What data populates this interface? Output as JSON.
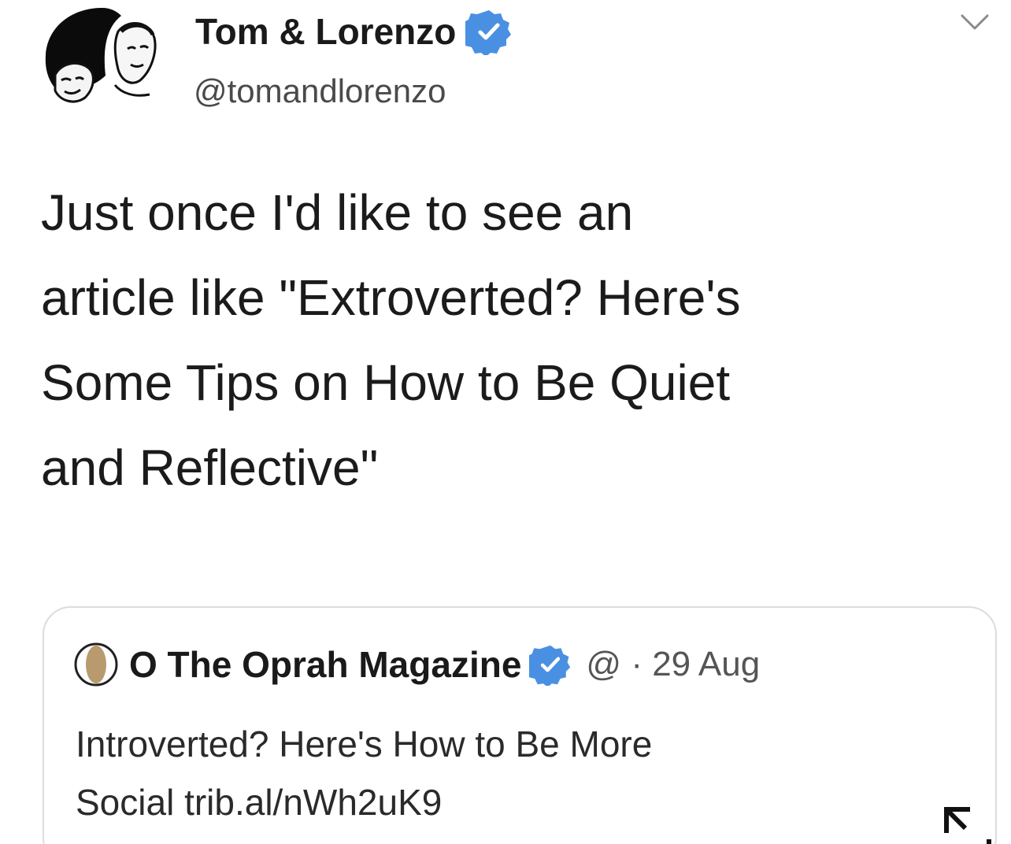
{
  "tweet": {
    "author_name": "Tom & Lorenzo",
    "handle": "@tomandlorenzo",
    "text": "Just once I'd like to see an\narticle like \"Extroverted? Here's\nSome Tips on How to Be Quiet\nand Reflective\"",
    "verified": true,
    "menu_icon": "chevron-down-icon"
  },
  "quoted_tweet": {
    "author_name": "O The Oprah Magazine",
    "meta": "@ · 29 Aug",
    "text": "Introverted? Here's How to Be More\nSocial trib.al/nWh2uK9",
    "verified": true
  },
  "colors": {
    "verified_blue": "#4a90e2",
    "text": "#1b1b1b",
    "secondary_text": "#555555",
    "card_border": "#dcdcdc"
  }
}
